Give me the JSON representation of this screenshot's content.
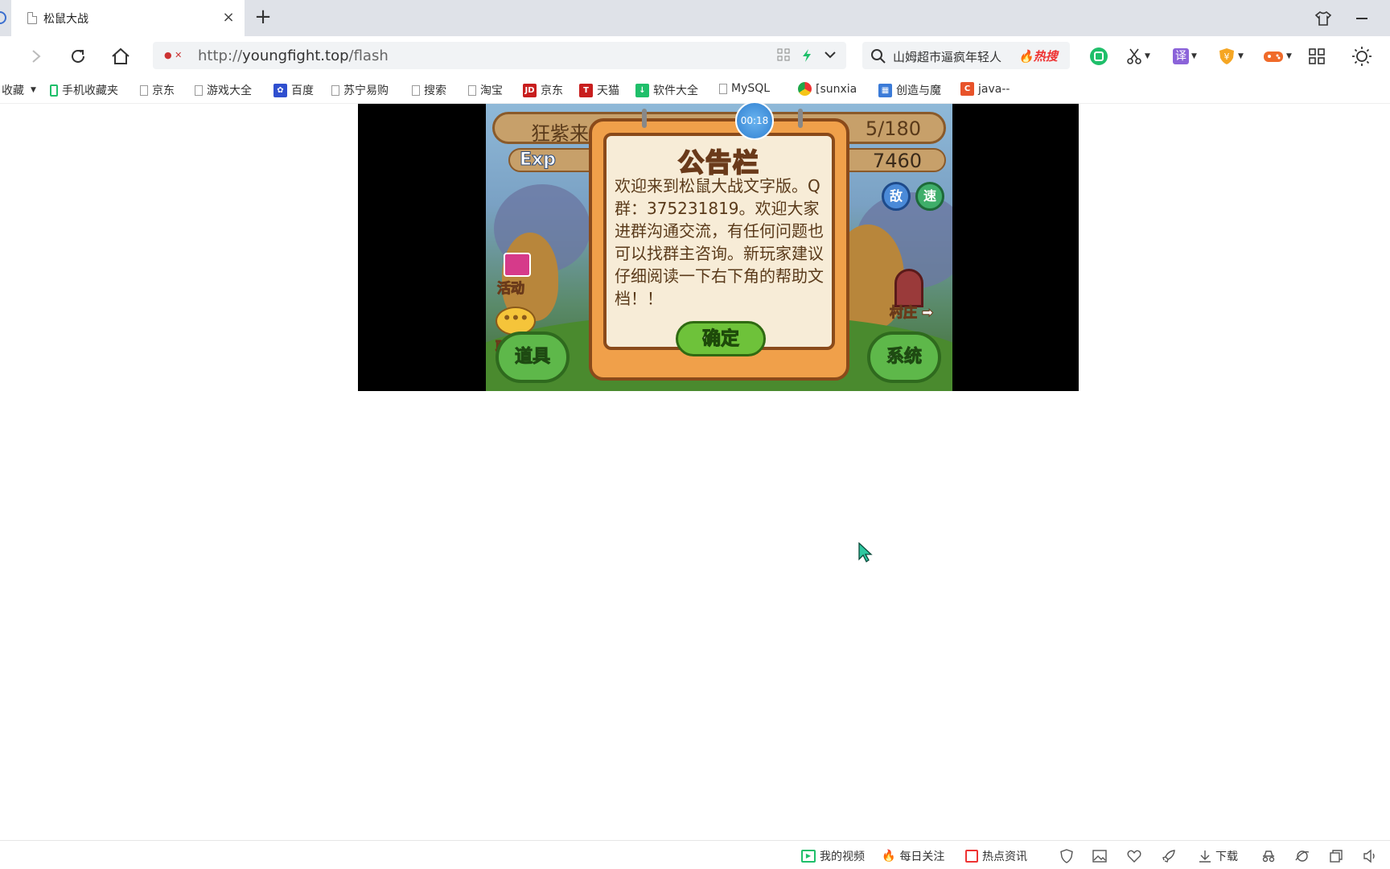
{
  "tab": {
    "title": "松鼠大战",
    "close": "×",
    "new_tab": "+"
  },
  "address": {
    "scheme": "http://",
    "host": "youngfight.top",
    "path": "/flash"
  },
  "search": {
    "query": "山姆超市逼疯年轻人",
    "hot_label": "热搜"
  },
  "extensions": {
    "translate_label": "译"
  },
  "bookmarks": [
    {
      "label": "收藏",
      "icon": "star-folder"
    },
    {
      "label": "手机收藏夹",
      "icon": "phone-icon"
    },
    {
      "label": "京东",
      "icon": "page-icon"
    },
    {
      "label": "游戏大全",
      "icon": "page-icon"
    },
    {
      "label": "百度",
      "icon": "baidu-paw-icon"
    },
    {
      "label": "苏宁易购",
      "icon": "page-icon"
    },
    {
      "label": "搜索",
      "icon": "page-icon"
    },
    {
      "label": "淘宝",
      "icon": "page-icon"
    },
    {
      "label": "京东",
      "icon": "jd-icon",
      "badge": "JD"
    },
    {
      "label": "天猫",
      "icon": "tmall-icon",
      "badge": "T"
    },
    {
      "label": "软件大全",
      "icon": "download-icon"
    },
    {
      "label": "MySQL",
      "icon": "page-icon"
    },
    {
      "label": "[sunxia",
      "icon": "chrome-icon"
    },
    {
      "label": "创造与魔",
      "icon": "grid-icon"
    },
    {
      "label": "java--",
      "icon": "csdn-icon",
      "badge": "C"
    }
  ],
  "game": {
    "player_name": "狂紫来",
    "hp": "5/180",
    "exp_label": "Exp",
    "exp_value": "7460",
    "timer": "00:18",
    "side_buttons": {
      "activity": "活动",
      "chat": "聊天",
      "village": "村庄"
    },
    "round_buttons": [
      "敌",
      "速"
    ],
    "bottom_buttons": {
      "items": "道具",
      "system": "系统"
    },
    "notice": {
      "title": "公告栏",
      "text": "欢迎来到松鼠大战文字版。Q群：375231819。欢迎大家进群沟通交流，有任何问题也可以找群主咨询。新玩家建议仔细阅读一下右下角的帮助文档！！",
      "confirm": "确定"
    }
  },
  "statusbar": {
    "my_video": "我的视频",
    "daily_focus": "每日关注",
    "hot_news": "热点资讯",
    "download": "下载"
  },
  "colors": {
    "tabbar_bg": "#dfe2e8",
    "hot": "#e33333",
    "accent_green": "#1fbf6a"
  }
}
